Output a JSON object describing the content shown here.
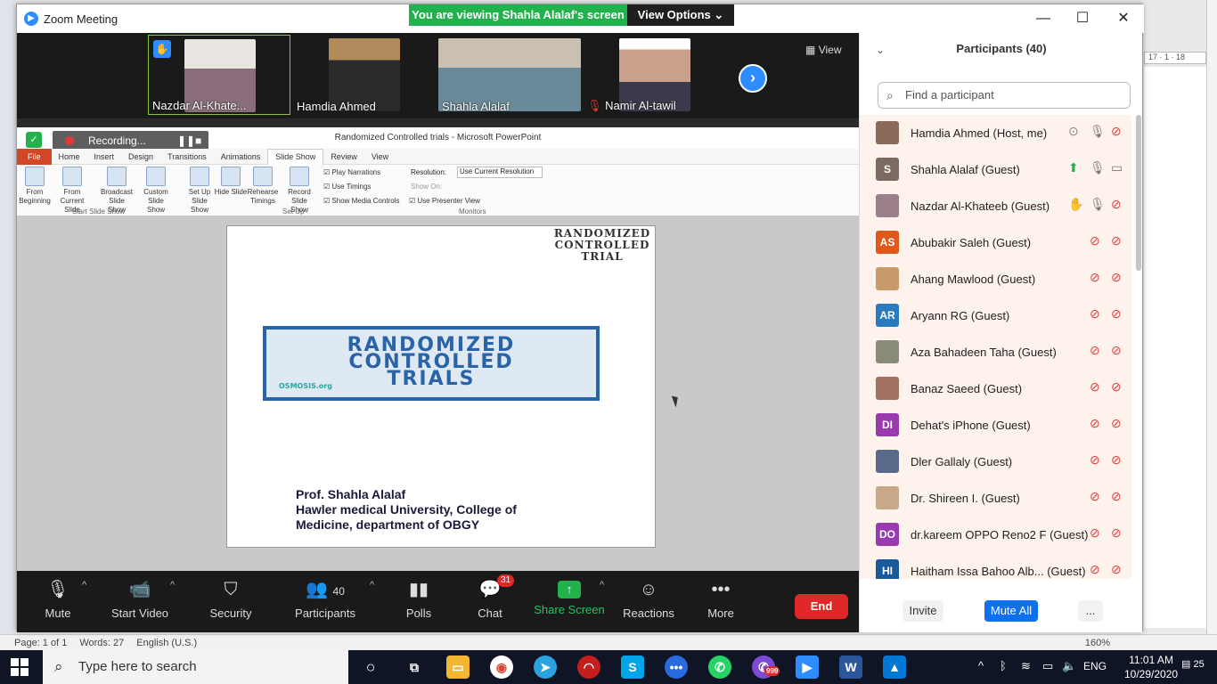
{
  "zoom": {
    "window_title": "Zoom Meeting",
    "viewing_banner": "You are viewing Shahla Alalaf's screen",
    "view_options": "View Options",
    "view_label": "View",
    "video_tiles": [
      {
        "name": "Nazdar Al-Khate..."
      },
      {
        "name": "Hamdia Ahmed"
      },
      {
        "name": "Shahla Alalaf"
      },
      {
        "name": "Namir Al-tawil"
      }
    ],
    "recording_label": "Recording...",
    "toolbar": {
      "mute": "Mute",
      "start_video": "Start Video",
      "security": "Security",
      "participants": "Participants",
      "participants_count": "40",
      "polls": "Polls",
      "chat": "Chat",
      "chat_badge": "31",
      "share_screen": "Share Screen",
      "reactions": "Reactions",
      "more": "More",
      "end": "End"
    }
  },
  "powerpoint": {
    "title": "Randomized Controlled trials - Microsoft PowerPoint",
    "tabs": [
      "File",
      "Home",
      "Insert",
      "Design",
      "Transitions",
      "Animations",
      "Slide Show",
      "Review",
      "View"
    ],
    "ribbon_buttons": [
      {
        "label": "From Beginning"
      },
      {
        "label": "From Current Slide"
      },
      {
        "label": "Broadcast Slide Show"
      },
      {
        "label": "Custom Slide Show"
      },
      {
        "label": "Set Up Slide Show"
      },
      {
        "label": "Hide Slide"
      },
      {
        "label": "Rehearse Timings"
      },
      {
        "label": "Record Slide Show"
      }
    ],
    "checkboxes": [
      "Play Narrations",
      "Use Timings",
      "Show Media Controls"
    ],
    "resolution_label": "Resolution:",
    "resolution_value": "Use Current Resolution",
    "show_on_label": "Show On:",
    "presenter_view": "Use Presenter View",
    "groups": [
      "Start Slide Show",
      "Set Up",
      "Monitors"
    ],
    "slide": {
      "wordcloud": "RANDOMIZED CONTROLLED TRIAL",
      "banner_line1": "RANDOMIZED",
      "banner_line2": "CONTROLLED",
      "banner_line3": "TRIALS",
      "banner_source": "OSMOSIS.org",
      "author_line1": "Prof. Shahla Alalaf",
      "author_line2": "Hawler medical University, College of",
      "author_line3": "Medicine, department of OBGY"
    }
  },
  "participants": {
    "title": "Participants (40)",
    "search_placeholder": "Find a participant",
    "list": [
      {
        "name": "Hamdia Ahmed (Host, me)",
        "initials": "",
        "color": "#8a6a5a",
        "extra": "record"
      },
      {
        "name": "Shahla Alalaf (Guest)",
        "initials": "S",
        "color": "#7a6a62",
        "extra": "share"
      },
      {
        "name": "Nazdar Al-Khateeb (Guest)",
        "initials": "",
        "color": "#9a7f8a",
        "extra": "hand"
      },
      {
        "name": "Abubakir Saleh (Guest)",
        "initials": "AS",
        "color": "#e0581a",
        "extra": ""
      },
      {
        "name": "Ahang Mawlood (Guest)",
        "initials": "",
        "color": "#c99a6a",
        "extra": ""
      },
      {
        "name": "Aryann RG (Guest)",
        "initials": "AR",
        "color": "#2a7abf",
        "extra": ""
      },
      {
        "name": "Aza Bahadeen Taha (Guest)",
        "initials": "",
        "color": "#8a8a7a",
        "extra": ""
      },
      {
        "name": "Banaz Saeed (Guest)",
        "initials": "",
        "color": "#a07060",
        "extra": ""
      },
      {
        "name": "Dehat's iPhone (Guest)",
        "initials": "DI",
        "color": "#9a3ab0",
        "extra": ""
      },
      {
        "name": "Dler Gallaly (Guest)",
        "initials": "",
        "color": "#5a6a8a",
        "extra": ""
      },
      {
        "name": "Dr. Shireen I. (Guest)",
        "initials": "",
        "color": "#c9a88a",
        "extra": ""
      },
      {
        "name": "dr.kareem OPPO Reno2 F (Guest)",
        "initials": "DO",
        "color": "#9a3ab0",
        "extra": ""
      },
      {
        "name": "Haitham Issa Bahoo Alb... (Guest)",
        "initials": "HI",
        "color": "#1a5a9a",
        "extra": ""
      }
    ],
    "invite": "Invite",
    "mute_all": "Mute All",
    "more": "..."
  },
  "word_status": {
    "page": "Page: 1 of 1",
    "words": "Words: 27",
    "language": "English (U.S.)",
    "zoom_level": "160%",
    "ruler": "17 · 1 · 18"
  },
  "taskbar": {
    "search_placeholder": "Type here to search",
    "badge_viber": "999",
    "language": "ENG",
    "time": "11:01 AM",
    "date": "10/29/2020",
    "notifications": "25"
  }
}
